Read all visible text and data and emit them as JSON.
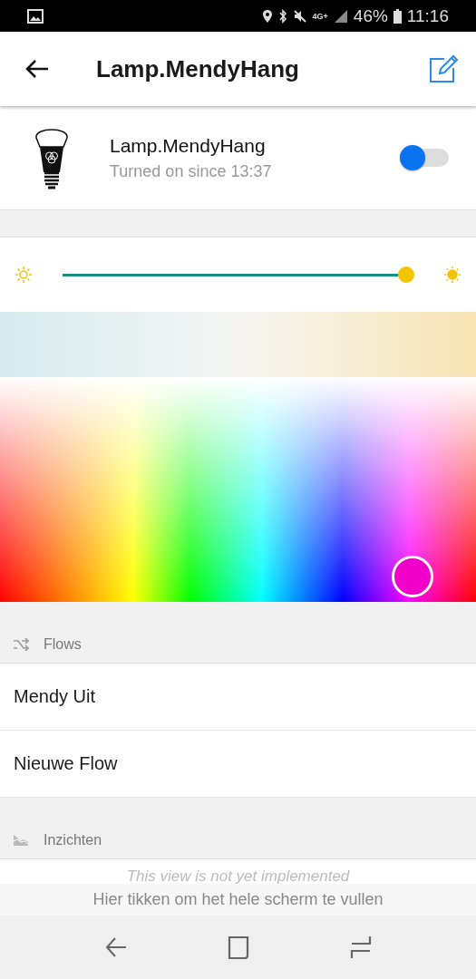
{
  "status_bar": {
    "battery": "46%",
    "time": "11:16",
    "network": "4G+"
  },
  "header": {
    "title": "Lamp.MendyHang"
  },
  "device": {
    "name": "Lamp.MendyHang",
    "subtitle": "Turned on since 13:37",
    "on": true
  },
  "brightness": {
    "level": 1.0
  },
  "color_picker": {
    "color": "#f000c8"
  },
  "flows": {
    "title": "Flows",
    "items": [
      {
        "label": "Mendy Uit"
      },
      {
        "label": "Nieuwe Flow"
      }
    ]
  },
  "insights": {
    "title": "Inzichten",
    "message": "This view is not yet implemented"
  },
  "fullscreen_hint": "Hier tikken om het hele scherm te vullen"
}
